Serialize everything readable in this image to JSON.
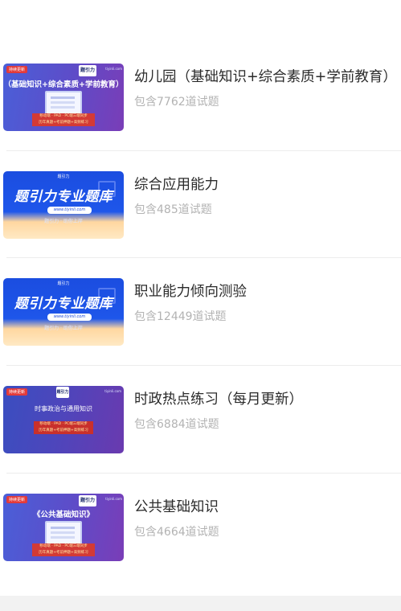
{
  "items": [
    {
      "title": "幼儿园（基础知识+综合素质+学前教育）",
      "count": "包含7762道试题",
      "thumb": {
        "tag": "持续更新",
        "logo": "题引力",
        "url": "tiyinli.com",
        "headline": "（基础知识+综合素质+学前教育）",
        "bar1": "移动端 · PAD · PC端三端同步",
        "bar2": "历年真题+考前押题+高频练习"
      }
    },
    {
      "title": "综合应用能力",
      "count": "包含485道试题",
      "thumb": {
        "logo": "题引力",
        "headline": "题引力专业题库",
        "url": "www.tiyinli.com",
        "slogan": "题引力 · 助你上岸"
      }
    },
    {
      "title": "职业能力倾向测验",
      "count": "包含12449道试题",
      "thumb": {
        "logo": "题引力",
        "headline": "题引力专业题库",
        "url": "www.tiyinli.com",
        "slogan": "题引力 · 助你上岸"
      }
    },
    {
      "title": "时政热点练习（每月更新）",
      "count": "包含6884道试题",
      "thumb": {
        "tag": "持续更新",
        "logo": "题引力",
        "url": "tiyinli.com",
        "headline": "时事政治与通用知识",
        "bar1": "移动端 · PAD · PC端三端同步",
        "bar2": "历年真题+考前押题+高频练习"
      }
    },
    {
      "title": "公共基础知识",
      "count": "包含4664道试题",
      "thumb": {
        "tag": "持续更新",
        "logo": "题引力",
        "url": "tiyinli.com",
        "headline": "《公共基础知识》",
        "bar1": "移动端 · PAD · PC端三端同步",
        "bar2": "历年真题+考前押题+高频练习"
      }
    }
  ]
}
